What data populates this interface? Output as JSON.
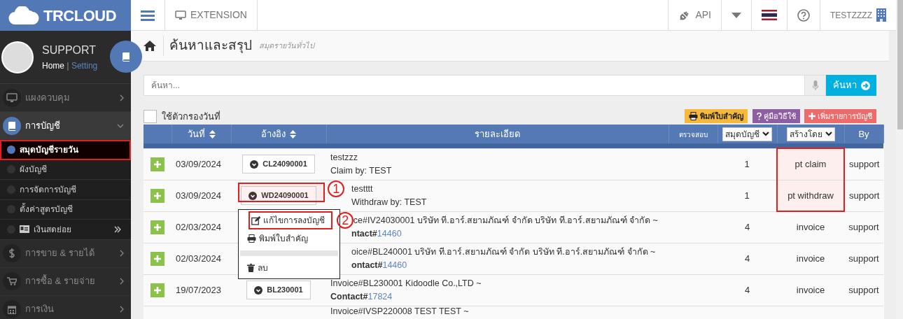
{
  "brand": {
    "name": "TRCLOUD"
  },
  "topbar": {
    "left": [
      {
        "kind": "menu"
      },
      {
        "kind": "extension",
        "label": "EXTENSION"
      }
    ],
    "right": [
      {
        "kind": "api",
        "label": "API"
      },
      {
        "kind": "caret"
      },
      {
        "kind": "flag"
      },
      {
        "kind": "help"
      },
      {
        "kind": "user",
        "label": "TESTZZZZ"
      }
    ]
  },
  "profile": {
    "name": "SUPPORT",
    "separator": "|",
    "links": [
      {
        "label": "Home",
        "selected": true
      },
      {
        "label": "Setting",
        "selected": false
      }
    ]
  },
  "sidebar": {
    "items": [
      {
        "label": "แผงควบคุม",
        "kind": "monitor",
        "expanded": false
      },
      {
        "label": "การบัญชี",
        "kind": "book",
        "expanded": true,
        "children": [
          {
            "label": "สมุดบัญชีรายวัน",
            "selected": true,
            "highlighted": true
          },
          {
            "label": "ผังบัญชี",
            "selected": false
          },
          {
            "label": "การจัดการบัญชี",
            "selected": false
          },
          {
            "label": "ตั้งค่าสูตรบัญชี",
            "selected": false
          },
          {
            "label": "เงินสดย่อย",
            "selected": false,
            "kind": "cash"
          }
        ]
      },
      {
        "label": "การขาย & รายได้",
        "kind": "dollar",
        "expanded": false
      },
      {
        "label": "การซื้อ & รายจ่าย",
        "kind": "cart",
        "expanded": false
      },
      {
        "label": "การเงิน",
        "kind": "calendar",
        "expanded": false
      }
    ]
  },
  "page": {
    "title": "ค้นหาและสรุป",
    "subtitle": "สมุดรายวันทั่วไป"
  },
  "search": {
    "placeholder": "ค้นหา...",
    "button": "ค้นหา"
  },
  "date_filter": {
    "label": "ใช้ตัวกรองวันที่",
    "checked": false
  },
  "actions": [
    {
      "label": "พิมพ์ใบสำคัญ",
      "kind": "print"
    },
    {
      "label": "คู่มือวิธีใช้",
      "kind": "help"
    },
    {
      "label": "เพิ่มรายการบัญชี",
      "kind": "add"
    }
  ],
  "table": {
    "columns": [
      {
        "label": "วันที่",
        "kind": "sort"
      },
      {
        "label": "อ้างอิง",
        "kind": "sort"
      },
      {
        "label": "รายละเอียด",
        "kind": "text"
      },
      {
        "label": "ตรวจสอบ",
        "kind": "small"
      },
      {
        "label": "สมุดบัญชี",
        "kind": "select"
      },
      {
        "label": "สร้างโดย",
        "kind": "select"
      },
      {
        "label": "By",
        "kind": "text"
      }
    ],
    "rows": [
      {
        "date": "03/09/2024",
        "ref": "CL24090001",
        "lines": [
          "testzzz",
          "Claim by: TEST"
        ],
        "count": "1",
        "category": "pt claim",
        "by": "support",
        "category_highlighted": true
      },
      {
        "date": "03/09/2024",
        "ref": "WD24090001",
        "ref_highlighted": true,
        "marker": "1",
        "lines": [
          "testttt",
          "Withdraw by: TEST"
        ],
        "count": "1",
        "category": "pt withdraw",
        "by": "support",
        "category_highlighted": true,
        "menu": [
          {
            "label": "แก้ไขการลงบัญชี",
            "kind": "edit",
            "highlighted": true,
            "marker": "2"
          },
          {
            "label": "พิมพ์ใบสำคัญ",
            "kind": "print"
          },
          {
            "kind": "divider"
          },
          {
            "label": "ลบ",
            "kind": "delete"
          }
        ]
      },
      {
        "kind": "covered",
        "date": "02/03/2024",
        "lines": [
          "ice#IV24030001 บริษัท ที.อาร์.สยามภัณฑ์ จำกัด บริษัท ที.อาร์.สยามภัณฑ์ จำกัด ~"
        ],
        "contact_label": "ntact#",
        "contact": "14460",
        "count": "4",
        "category": "invoice",
        "by": "support"
      },
      {
        "kind": "covered",
        "date": "02/03/2024",
        "lines": [
          "oice#BL240001 บริษัท ที.อาร์.สยามภัณฑ์ จำกัด บริษัท ที.อาร์.สยามภัณฑ์ จำกัด ~"
        ],
        "contact_label": "ontact#",
        "contact": "14460",
        "count": "4",
        "category": "invoice",
        "by": "support"
      },
      {
        "date": "19/07/2023",
        "ref": "BL230001",
        "lines": [
          "Invoice#BL230001 Kidoodle Co.,LTD ~"
        ],
        "contact_label": "Contact#",
        "contact": "17824",
        "count": "4",
        "category": "invoice",
        "by": "support"
      },
      {
        "kind": "partial",
        "lines": [
          "Invoice#IVSP220008 TEST TEST ~"
        ]
      }
    ]
  }
}
